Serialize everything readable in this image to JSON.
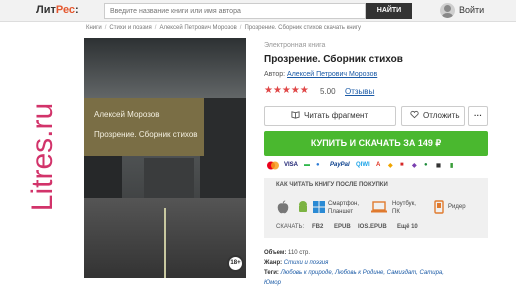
{
  "header": {
    "logo_main": "Лит",
    "logo_accent": "Рес",
    "logo_colon": ":",
    "search_placeholder": "Введите название книги или имя автора",
    "search_button": "НАЙТИ",
    "login": "Войти"
  },
  "breadcrumb": [
    "Книги",
    "Стихи и поэзия",
    "Алексей Петрович Морозов",
    "Прозрение. Сборник стихов скачать книгу"
  ],
  "side_brand": "Litres.ru",
  "cover": {
    "author": "Алексей Морозов",
    "title": "Прозрение. Сборник стихов",
    "age": "18+"
  },
  "book": {
    "type": "Электронная книга",
    "title": "Прозрение. Сборник стихов",
    "author_label": "Автор:",
    "author": "Алексей Петрович Морозов",
    "stars": "★★★★★",
    "rating": "5.00",
    "reviews": "Отзывы"
  },
  "actions": {
    "read": "Читать фрагмент",
    "defer": "Отложить",
    "more": "···",
    "buy": "КУПИТЬ И СКАЧАТЬ ЗА 149 ₽"
  },
  "payments": [
    "VISA",
    "PayPal",
    "QIWI"
  ],
  "how_to": {
    "title": "КАК ЧИТАТЬ КНИГУ ПОСЛЕ ПОКУПКИ",
    "devices": [
      {
        "label": "Смартфон,",
        "label2": "Планшет"
      },
      {
        "label": "Ноутбук,",
        "label2": "ПК"
      },
      {
        "label": "Ридер",
        "label2": ""
      }
    ],
    "download_label": "СКАЧАТЬ:",
    "formats": [
      "FB2",
      "EPUB",
      "IOS.EPUB",
      "Ещё 10"
    ]
  },
  "meta": {
    "volume_label": "Объем:",
    "volume": "110 стр.",
    "genre_label": "Жанр:",
    "genre": "Стихи и поэзия",
    "tags_label": "Теги:",
    "tags": "Любовь к природе, Любовь к Родине, Самиздат, Сатира,",
    "tags2": "Юмор"
  },
  "colors": {
    "accent_logo": "#e4572e",
    "brand_pink": "#d2336a",
    "buy_green": "#4ab82f",
    "star_red": "#e04848",
    "link_blue": "#1a5aa6"
  }
}
